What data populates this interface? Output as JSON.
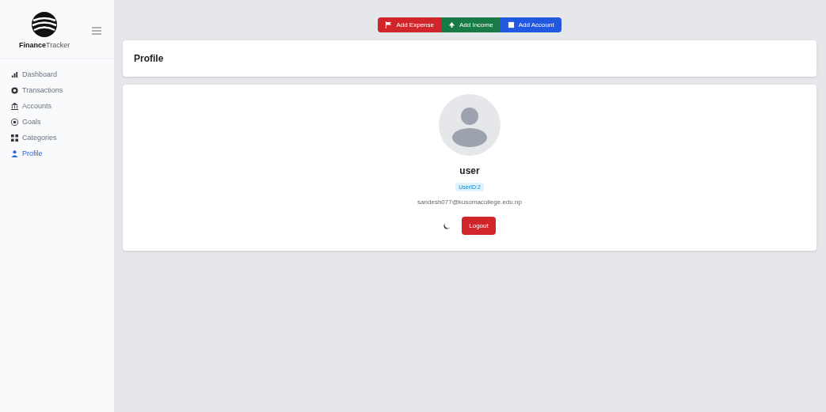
{
  "sidebar": {
    "brand_bold": "Finance",
    "brand_light": "Tracker",
    "items": [
      {
        "label": "Dashboard",
        "kind": "chart",
        "selected": false
      },
      {
        "label": "Transactions",
        "kind": "cycle",
        "selected": false
      },
      {
        "label": "Accounts",
        "kind": "bank",
        "selected": false
      },
      {
        "label": "Goals",
        "kind": "target",
        "selected": false
      },
      {
        "label": "Categories",
        "kind": "grid",
        "selected": false
      },
      {
        "label": "Profile",
        "kind": "user",
        "selected": true
      }
    ]
  },
  "actions": [
    {
      "label": "Add Expense",
      "color": "#d0262b",
      "kind": "flag"
    },
    {
      "label": "Add Income",
      "color": "#177a47",
      "kind": "up"
    },
    {
      "label": "Add Account",
      "color": "#2257e0",
      "kind": "card"
    }
  ],
  "header": {
    "title": "Profile"
  },
  "profile": {
    "name": "user",
    "badge": "UserID:2",
    "email": "sandesh077@kusomacollege.edu.np",
    "logout": "Logout"
  }
}
